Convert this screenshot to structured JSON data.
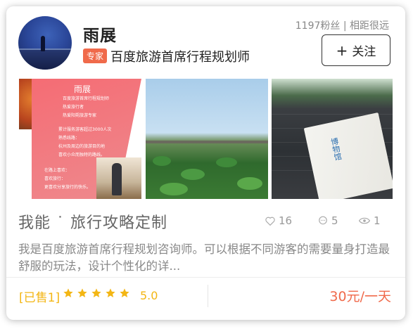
{
  "provider": {
    "name": "雨展",
    "badge": "专家",
    "title": "百度旅游首席行程规划师",
    "stats": "1197粉丝 | 相距很远",
    "follow_label": "关注"
  },
  "gallery": {
    "poster_title": "雨展",
    "poster_lines": [
      "百度旅游首席行程规划师",
      "热爱旅行者",
      "热爱阳朔旅游专家",
      "累计服务游客超过3000人次",
      "熟悉线路：",
      "杭州及周边的旅游目的地",
      "喜欢小众而独特的路线。",
      "在路上喜欢：",
      "喜欢旅行：",
      "更喜欢分享旅行的快乐。"
    ],
    "book_text": "博物馆"
  },
  "service": {
    "title": "我能 ˙ 旅行攻略定制",
    "likes": "16",
    "comments": "5",
    "views": "1",
    "description": "我是百度旅游首席行程规划咨询师。可以根据不同游客的需要量身打造最舒服的玩法，设计个性化的详..."
  },
  "footer": {
    "sold": "[已售1]",
    "stars": 5,
    "rating": "5.0",
    "price": "30元/一天"
  },
  "colors": {
    "accent": "#f06a4b",
    "gold": "#f3b614",
    "text": "#222222",
    "muted": "#888888"
  }
}
